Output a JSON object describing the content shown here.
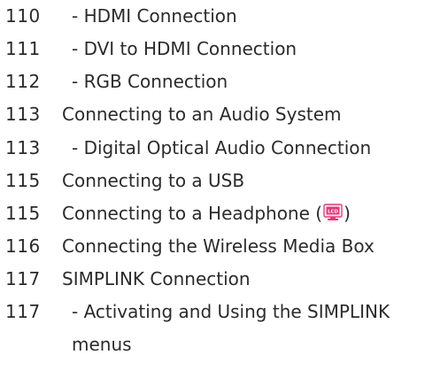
{
  "entries": [
    {
      "page": "110",
      "title": "- HDMI Connection",
      "sub": true
    },
    {
      "page": "111",
      "title": "- DVI to HDMI Connection",
      "sub": true
    },
    {
      "page": "112",
      "title": "- RGB Connection",
      "sub": true
    },
    {
      "page": "113",
      "title": "Connecting to an Audio System",
      "sub": false
    },
    {
      "page": "113",
      "title": "- Digital Optical Audio Connection",
      "sub": true
    },
    {
      "page": "115",
      "title": "Connecting to a USB",
      "sub": false
    },
    {
      "page": "115",
      "title_before": "Connecting to a Headphone (",
      "icon": "lcd-icon",
      "icon_label": "LCD",
      "title_after": ")",
      "sub": false
    },
    {
      "page": "116",
      "title": "Connecting the Wireless Media Box",
      "sub": false
    },
    {
      "page": "117",
      "title": "SIMPLINK Connection",
      "sub": false
    },
    {
      "page": "117",
      "title": "- Activating and Using the SIMPLINK menus",
      "sub": true
    }
  ],
  "colors": {
    "text": "#2b2b2b",
    "icon_accent": "#e8357a"
  }
}
